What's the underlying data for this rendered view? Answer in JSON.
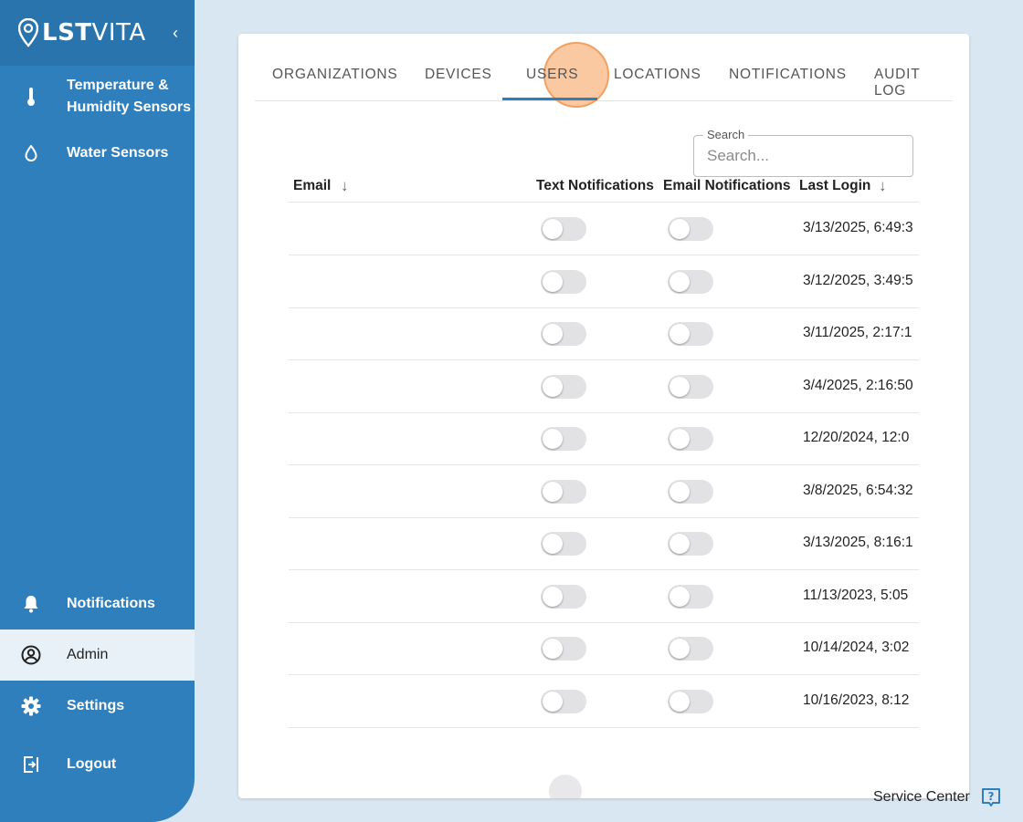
{
  "brand": {
    "name_bold": "LST",
    "name_thin": "VITA",
    "collapse_glyph": "‹"
  },
  "sidebar": {
    "items": [
      {
        "label": "Temperature &\nHumidity Sensors",
        "icon": "thermometer-icon"
      },
      {
        "label": "Water Sensors",
        "icon": "water-drop-icon"
      },
      {
        "label": "Notifications",
        "icon": "bell-icon"
      },
      {
        "label": "Admin",
        "icon": "user-circle-icon",
        "active": true
      },
      {
        "label": "Settings",
        "icon": "gear-icon"
      },
      {
        "label": "Logout",
        "icon": "logout-icon"
      }
    ]
  },
  "tabs": [
    {
      "label": "ORGANIZATIONS"
    },
    {
      "label": "DEVICES"
    },
    {
      "label": "USERS",
      "active": true
    },
    {
      "label": "LOCATIONS"
    },
    {
      "label": "NOTIFICATIONS"
    },
    {
      "label": "AUDIT LOG"
    }
  ],
  "search": {
    "legend": "Search",
    "placeholder": "Search...",
    "value": ""
  },
  "table": {
    "headers": {
      "email": "Email",
      "text_notifications": "Text Notifications",
      "email_notifications": "Email Notifications",
      "last_login": "Last Login"
    },
    "rows": [
      {
        "email": "",
        "text_notifications": false,
        "email_notifications": false,
        "last_login": "3/13/2025, 6:49:3"
      },
      {
        "email": "",
        "text_notifications": false,
        "email_notifications": false,
        "last_login": "3/12/2025, 3:49:5"
      },
      {
        "email": "",
        "text_notifications": false,
        "email_notifications": false,
        "last_login": "3/11/2025, 2:17:1"
      },
      {
        "email": "",
        "text_notifications": false,
        "email_notifications": false,
        "last_login": "3/4/2025, 2:16:50"
      },
      {
        "email": "",
        "text_notifications": false,
        "email_notifications": false,
        "last_login": "12/20/2024, 12:0"
      },
      {
        "email": "",
        "text_notifications": false,
        "email_notifications": false,
        "last_login": "3/8/2025, 6:54:32"
      },
      {
        "email": "",
        "text_notifications": false,
        "email_notifications": false,
        "last_login": "3/13/2025, 8:16:1"
      },
      {
        "email": "",
        "text_notifications": false,
        "email_notifications": false,
        "last_login": "11/13/2023, 5:05"
      },
      {
        "email": "",
        "text_notifications": false,
        "email_notifications": false,
        "last_login": "10/14/2024, 3:02"
      },
      {
        "email": "",
        "text_notifications": false,
        "email_notifications": false,
        "last_login": "10/16/2023, 8:12"
      }
    ]
  },
  "service_center": {
    "label": "Service Center",
    "icon": "help-icon"
  },
  "colors": {
    "sidebar": "#2f7fbd",
    "accent": "#2f7fbd",
    "page_bg": "#d8e7f1",
    "click_highlight": "#f7aa6e"
  }
}
